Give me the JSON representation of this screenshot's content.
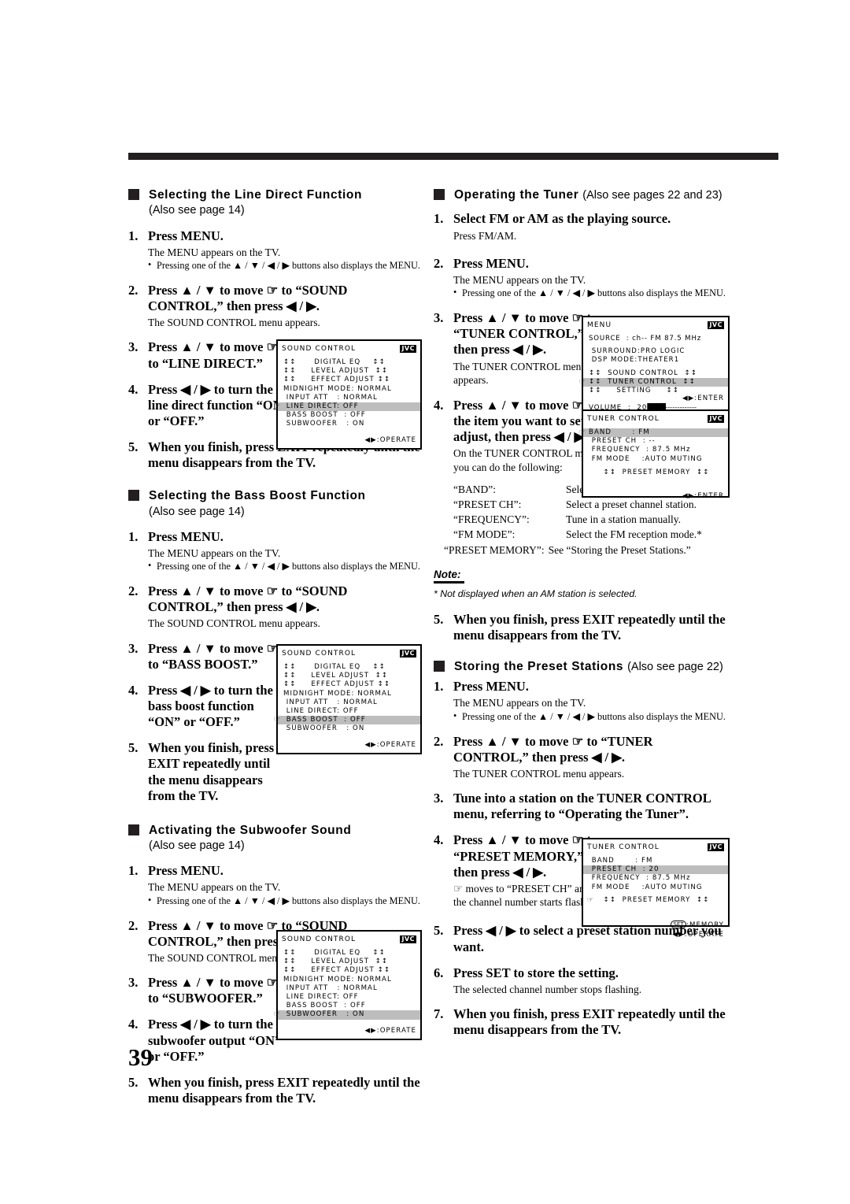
{
  "page": {
    "number": "39"
  },
  "osd_common": {
    "brand": "JVC",
    "operate_foot": "◀▶:OPERATE",
    "enter_foot": "◀▶:ENTER",
    "memory_foot": "SET",
    "memory_label": ":MEMORY",
    "operate_label": ":OPERATE",
    "cursor_glyph": "☞"
  },
  "left": {
    "sections": [
      {
        "heading": "Selecting the Line Direct Function",
        "also_see": "(Also see page 14)",
        "steps": [
          {
            "num": "1.",
            "title": "Press MENU.",
            "body": "The MENU appears on the TV.",
            "bullet": "Pressing one of the ▲ / ▼ / ◀ / ▶ buttons also displays the MENU."
          },
          {
            "num": "2.",
            "title": "Press ▲ / ▼ to move ☞ to “SOUND CONTROL,” then press ◀ / ▶.",
            "body": "The SOUND CONTROL menu appears."
          },
          {
            "num": "3.",
            "title": "Press ▲ / ▼ to move ☞ to “LINE DIRECT.”"
          },
          {
            "num": "4.",
            "title": "Press ◀ / ▶ to turn the line direct function “ON” or “OFF.”"
          },
          {
            "num": "5.",
            "title": "When you finish, press EXIT repeatedly until the menu disappears from the TV."
          }
        ]
      },
      {
        "heading": "Selecting the Bass Boost Function",
        "also_see": "(Also see page 14)",
        "steps": [
          {
            "num": "1.",
            "title": "Press MENU.",
            "body": "The MENU appears on the TV.",
            "bullet": "Pressing one of the ▲ / ▼ / ◀ / ▶ buttons also displays the MENU."
          },
          {
            "num": "2.",
            "title": "Press ▲ / ▼ to move ☞ to “SOUND CONTROL,” then press ◀ / ▶.",
            "body": "The SOUND CONTROL menu appears."
          },
          {
            "num": "3.",
            "title": "Press ▲ / ▼ to move ☞ to “BASS BOOST.”"
          },
          {
            "num": "4.",
            "title": "Press ◀ / ▶ to turn the bass boost function “ON” or “OFF.”"
          },
          {
            "num": "5.",
            "title": "When you finish, press EXIT repeatedly until the menu disappears from the TV."
          }
        ]
      },
      {
        "heading": "Activating the Subwoofer Sound",
        "also_see": "(Also see page 14)",
        "steps": [
          {
            "num": "1.",
            "title": "Press MENU.",
            "body": "The MENU appears on the TV.",
            "bullet": "Pressing one of the ▲ / ▼ / ◀ / ▶ buttons also displays the MENU."
          },
          {
            "num": "2.",
            "title": "Press ▲ / ▼ to move ☞ to “SOUND CONTROL,” then press ◀ / ▶.",
            "body": "The SOUND CONTROL menu appears."
          },
          {
            "num": "3.",
            "title": "Press ▲ / ▼ to move ☞ to “SUBWOOFER.”"
          },
          {
            "num": "4.",
            "title": "Press ◀ / ▶ to turn the subwoofer output “ON” or “OFF.”"
          },
          {
            "num": "5.",
            "title": "When you finish, press EXIT repeatedly until the menu disappears from the TV."
          }
        ]
      }
    ],
    "osd_sound_control": {
      "title": "SOUND CONTROL",
      "lines": [
        "↕↕      DIGITAL EQ    ↕↕",
        "↕↕     LEVEL ADJUST  ↕↕",
        "↕↕     EFFECT ADJUST ↕↕",
        "MIDNIGHT MODE: NORMAL",
        " INPUT ATT   : NORMAL",
        " LINE DIRECT: OFF",
        " BASS BOOST  : OFF",
        " SUBWOOFER   : ON"
      ],
      "highlight_line_direct": 5,
      "highlight_bass_boost": 6,
      "highlight_subwoofer": 7
    }
  },
  "right": {
    "sections": [
      {
        "heading": "Operating the Tuner",
        "also_see": "(Also see pages 22 and 23)",
        "steps": [
          {
            "num": "1.",
            "title": "Select FM or AM as the playing source.",
            "body": "Press FM/AM."
          },
          {
            "num": "2.",
            "title": "Press MENU.",
            "body": "The MENU appears on the TV.",
            "bullet": "Pressing one of the ▲ / ▼ / ◀ / ▶ buttons also displays the MENU."
          },
          {
            "num": "3.",
            "title": "Press ▲ / ▼ to move ☞ to “TUNER CONTROL,” then press ◀ / ▶.",
            "body": "The TUNER CONTROL menu appears."
          },
          {
            "num": "4.",
            "title": "Press ▲ / ▼ to move ☞ to the item you want to set or adjust, then press ◀ / ▶.",
            "body": "On the TUNER CONTROL menu, you can do the following:"
          },
          {
            "num": "5.",
            "title": "When you finish, press EXIT repeatedly until the menu disappears from the TV."
          }
        ],
        "definitions": [
          {
            "key": "“BAND”:",
            "value": "Select the band."
          },
          {
            "key": "“PRESET CH”:",
            "value": "Select a preset channel station."
          },
          {
            "key": "“FREQUENCY”:",
            "value": "Tune in a station manually."
          },
          {
            "key": "“FM MODE”:",
            "value": "Select the FM reception mode.*"
          },
          {
            "key": "“PRESET MEMORY”:",
            "value": "See “Storing the Preset Stations.”"
          }
        ],
        "note_heading": "Note:",
        "note_body": "*  Not displayed when an AM station is selected."
      },
      {
        "heading": "Storing the Preset Stations",
        "also_see": "(Also see page 22)",
        "steps": [
          {
            "num": "1.",
            "title": "Press MENU.",
            "body": "The MENU appears on the TV.",
            "bullet": "Pressing one of the ▲ / ▼ / ◀ / ▶ buttons also displays the MENU."
          },
          {
            "num": "2.",
            "title": "Press ▲ / ▼ to move ☞ to “TUNER CONTROL,” then press ◀ / ▶.",
            "body": "The TUNER CONTROL menu appears."
          },
          {
            "num": "3.",
            "title": "Tune into a station on the TUNER CONTROL menu, referring to “Operating the Tuner”."
          },
          {
            "num": "4.",
            "title": "Press ▲ / ▼ to move ☞ to “PRESET MEMORY,” then press ◀ / ▶.",
            "body": "☞ moves to “PRESET CH” and the channel number starts flashing."
          },
          {
            "num": "5.",
            "title": "Press ◀ / ▶ to select a preset station number you want."
          },
          {
            "num": "6.",
            "title": "Press SET to store the setting.",
            "body": "The selected channel number stops flashing."
          },
          {
            "num": "7.",
            "title": "When you finish, press EXIT repeatedly until the menu disappears from the TV."
          }
        ]
      }
    ],
    "osd_menu": {
      "title": "MENU",
      "source_line": "SOURCE  : ch-- FM 87.5 MHz",
      "surround_line": " SURROUND:PRO LOGIC",
      "dsp_line": " DSP MODE:THEATER1",
      "sound_control_line": "↕↕  SOUND CONTROL  ↕↕",
      "tuner_control_line": "↕↕  TUNER CONTROL  ↕↕",
      "setting_line": "↕↕     SETTING     ↕↕",
      "enter_line": "◀▶:ENTER",
      "volume_label": "VOLUME  :  20",
      "volume_bar": "████",
      "volume_dots": "-------------"
    },
    "osd_tuner_control_1": {
      "title": "TUNER CONTROL",
      "lines": [
        "BAND       : FM",
        " PRESET CH  : --",
        " FREQUENCY  : 87.5 MHz",
        " FM MODE    :AUTO MUTING"
      ],
      "preset_memory_line": "↕↕  PRESET MEMORY  ↕↕",
      "highlight": 0
    },
    "osd_tuner_control_2": {
      "title": "TUNER CONTROL",
      "lines": [
        " BAND       : FM",
        " PRESET CH  : 20",
        " FREQUENCY  : 87.5 MHz",
        " FM MODE    :AUTO MUTING"
      ],
      "preset_memory_line": "↕↕  PRESET MEMORY  ↕↕",
      "highlight": 1
    }
  }
}
